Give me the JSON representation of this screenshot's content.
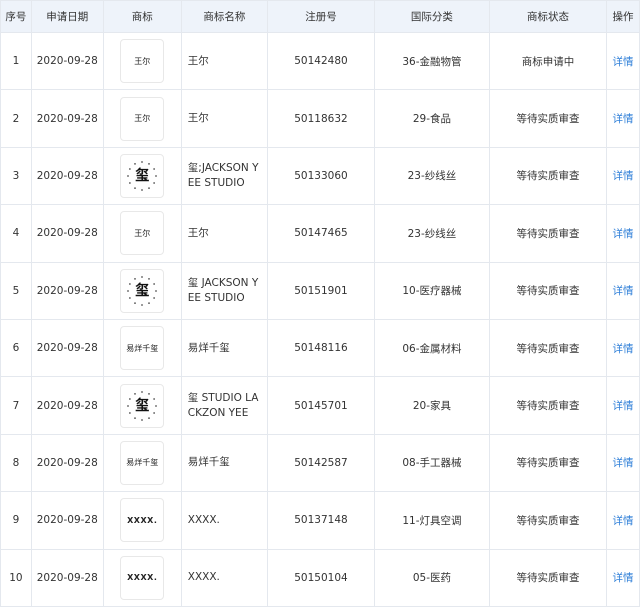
{
  "headers": [
    "序号",
    "申请日期",
    "商标",
    "商标名称",
    "注册号",
    "国际分类",
    "商标状态",
    "操作"
  ],
  "rows": [
    {
      "index": "1",
      "date": "2020-09-28",
      "logo": {
        "kind": "text",
        "text": "王尔"
      },
      "name": "王尔",
      "reg_no": "50142480",
      "class": "36-金融物管",
      "status": "商标申请中",
      "action": "详情"
    },
    {
      "index": "2",
      "date": "2020-09-28",
      "logo": {
        "kind": "text",
        "text": "王尔"
      },
      "name": "王尔",
      "reg_no": "50118632",
      "class": "29-食品",
      "status": "等待实质审查",
      "action": "详情"
    },
    {
      "index": "3",
      "date": "2020-09-28",
      "logo": {
        "kind": "seal",
        "text": "玺"
      },
      "name": "玺;JACKSON YEE STUDIO",
      "reg_no": "50133060",
      "class": "23-纱线丝",
      "status": "等待实质审查",
      "action": "详情"
    },
    {
      "index": "4",
      "date": "2020-09-28",
      "logo": {
        "kind": "text",
        "text": "王尔"
      },
      "name": "王尔",
      "reg_no": "50147465",
      "class": "23-纱线丝",
      "status": "等待实质审查",
      "action": "详情"
    },
    {
      "index": "5",
      "date": "2020-09-28",
      "logo": {
        "kind": "seal",
        "text": "玺"
      },
      "name": "玺 JACKSON YEE STUDIO",
      "reg_no": "50151901",
      "class": "10-医疗器械",
      "status": "等待实质审查",
      "action": "详情"
    },
    {
      "index": "6",
      "date": "2020-09-28",
      "logo": {
        "kind": "text",
        "text": "易烊千玺"
      },
      "name": "易烊千玺",
      "reg_no": "50148116",
      "class": "06-金属材料",
      "status": "等待实质审查",
      "action": "详情"
    },
    {
      "index": "7",
      "date": "2020-09-28",
      "logo": {
        "kind": "seal",
        "text": "玺"
      },
      "name": "玺 STUDIO LACKZON YEE",
      "reg_no": "50145701",
      "class": "20-家具",
      "status": "等待实质审查",
      "action": "详情"
    },
    {
      "index": "8",
      "date": "2020-09-28",
      "logo": {
        "kind": "text",
        "text": "易烊千玺"
      },
      "name": "易烊千玺",
      "reg_no": "50142587",
      "class": "08-手工器械",
      "status": "等待实质审查",
      "action": "详情"
    },
    {
      "index": "9",
      "date": "2020-09-28",
      "logo": {
        "kind": "text",
        "text": "XXXX."
      },
      "name": "XXXX.",
      "reg_no": "50137148",
      "class": "11-灯具空调",
      "status": "等待实质审查",
      "action": "详情"
    },
    {
      "index": "10",
      "date": "2020-09-28",
      "logo": {
        "kind": "text",
        "text": "XXXX."
      },
      "name": "XXXX.",
      "reg_no": "50150104",
      "class": "05-医药",
      "status": "等待实质审查",
      "action": "详情"
    }
  ],
  "colors": {
    "header_bg": "#eef3fa",
    "border": "#e4e8ee",
    "text": "#333333",
    "link": "#2f7fd8"
  }
}
